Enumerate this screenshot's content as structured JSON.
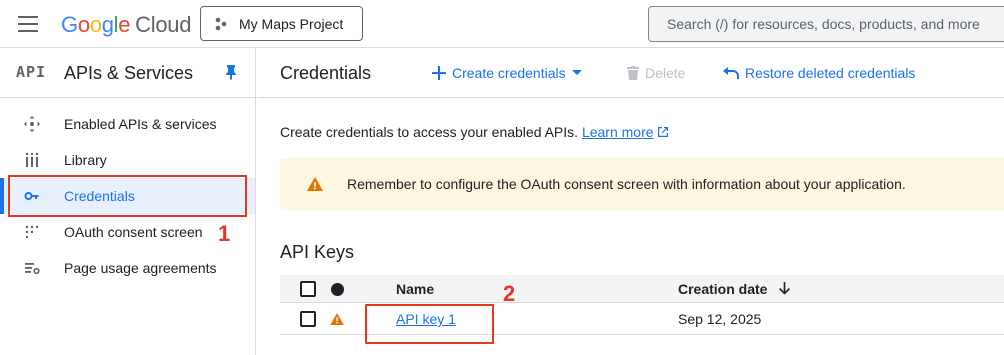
{
  "topbar": {
    "logo": {
      "letters": [
        "G",
        "o",
        "o",
        "g",
        "l",
        "e"
      ],
      "suffix": "Cloud"
    },
    "project": "My Maps Project",
    "search_placeholder": "Search (/) for resources, docs, products, and more"
  },
  "sidebar": {
    "badge": "API",
    "title": "APIs & Services",
    "items": [
      {
        "label": "Enabled APIs & services",
        "icon": "diamond-arrows-icon"
      },
      {
        "label": "Library",
        "icon": "library-grid-icon"
      },
      {
        "label": "Credentials",
        "icon": "key-icon",
        "active": true
      },
      {
        "label": "OAuth consent screen",
        "icon": "dots-grid-icon"
      },
      {
        "label": "Page usage agreements",
        "icon": "settings-list-icon"
      }
    ]
  },
  "main": {
    "title": "Credentials",
    "toolbar": {
      "create": "Create credentials",
      "delete": "Delete",
      "restore": "Restore deleted credentials"
    },
    "intro": "Create credentials to access your enabled APIs.",
    "learn_more": "Learn more",
    "warning": "Remember to configure the OAuth consent screen with information about your application.",
    "section_title": "API Keys",
    "table": {
      "headers": {
        "name": "Name",
        "date": "Creation date"
      },
      "rows": [
        {
          "name": "API key 1",
          "date": "Sep 12, 2025",
          "status": "warning"
        }
      ]
    }
  },
  "annotations": {
    "step1": "1",
    "step2": "2"
  },
  "colors": {
    "accent": "#1a73e8",
    "highlight": "#e8361f",
    "warning": "#e37400"
  }
}
